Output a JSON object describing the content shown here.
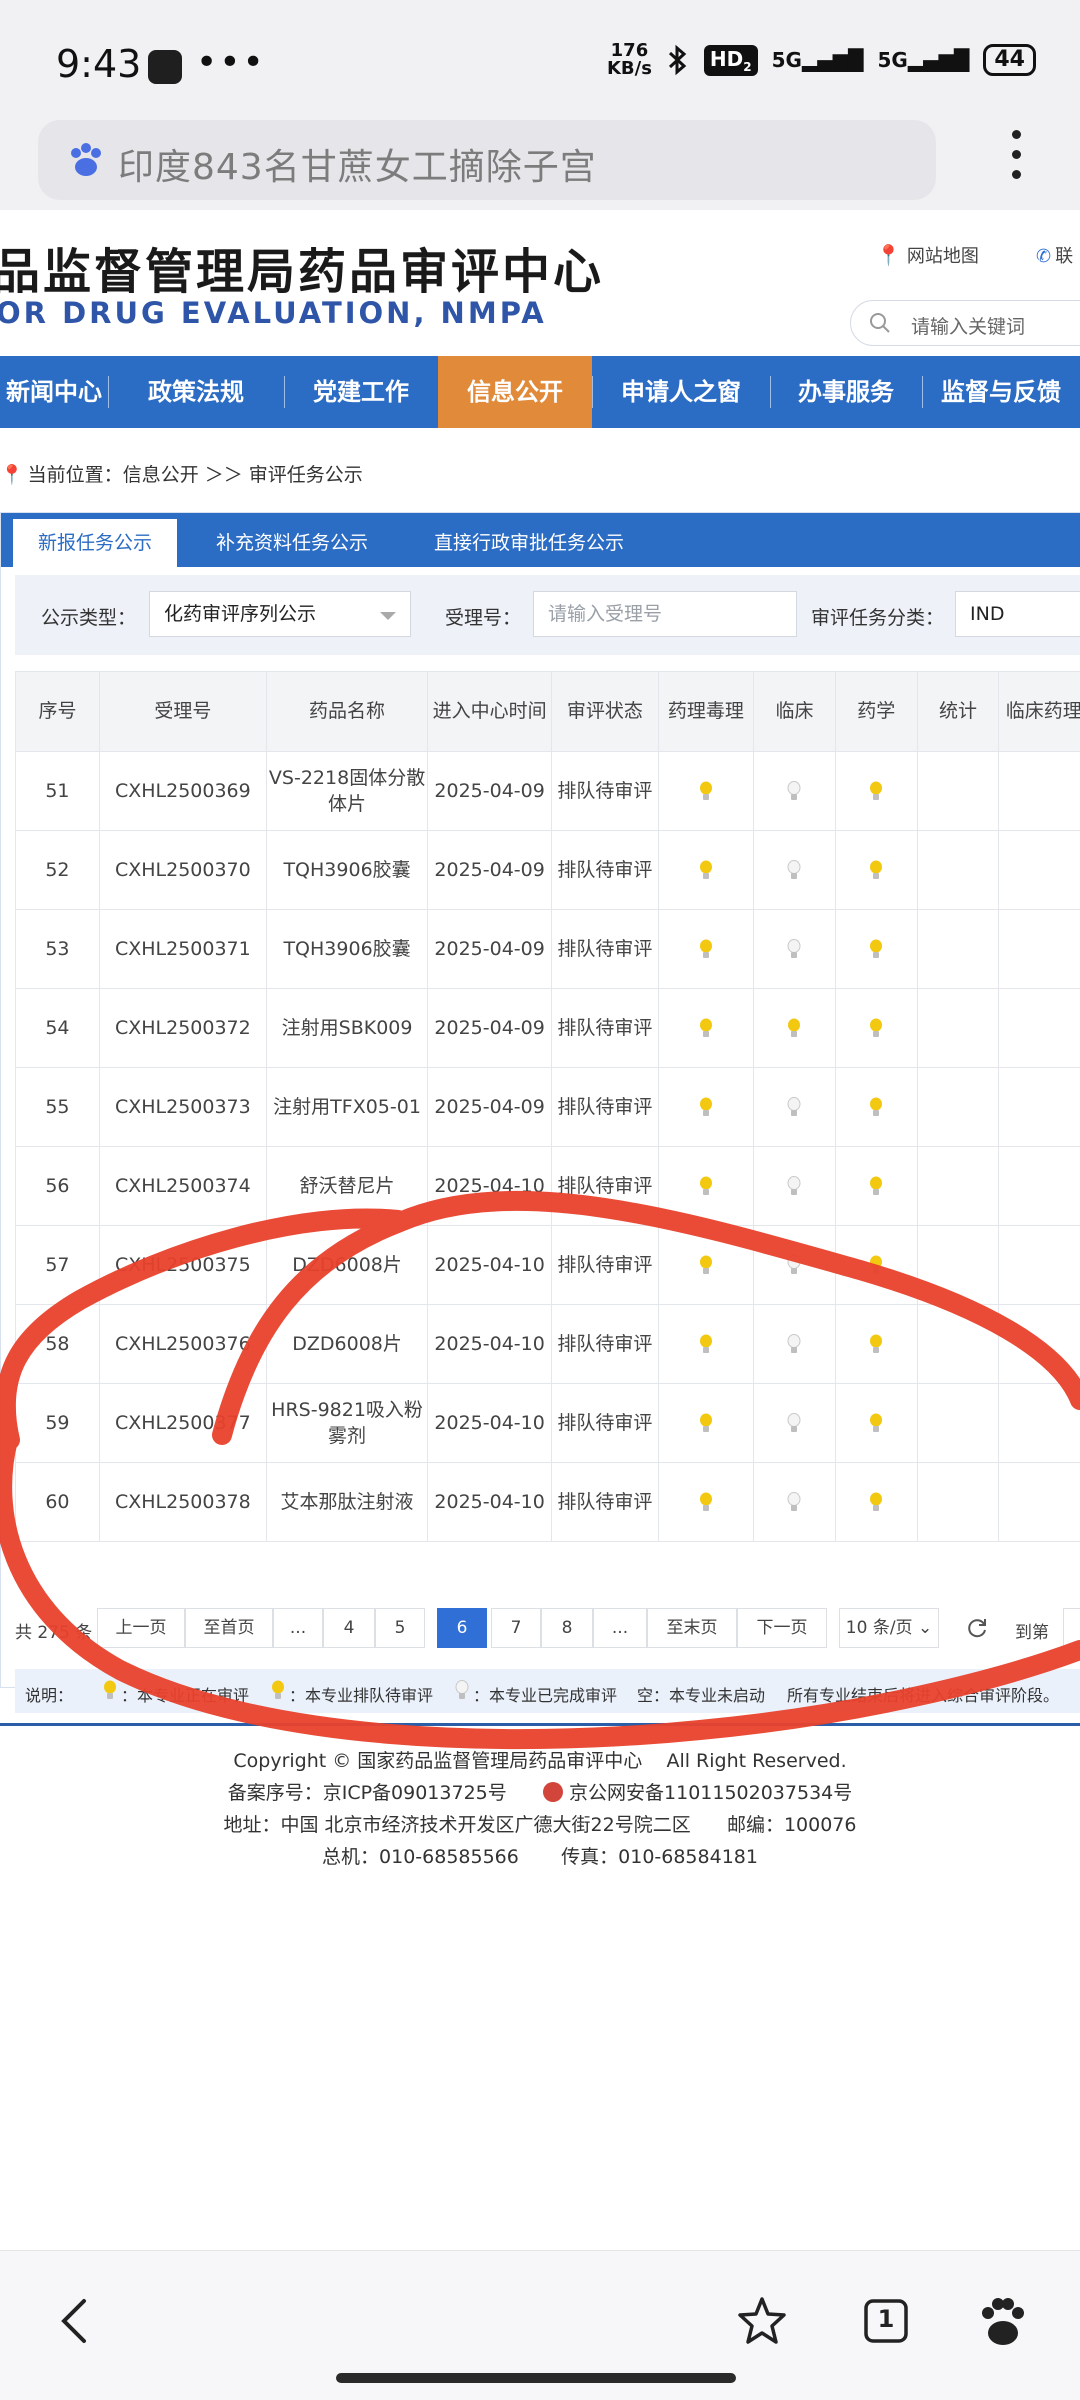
{
  "status_bar": {
    "time": "9:43",
    "dots": "•••",
    "net_speed_top": "176",
    "net_speed_bottom": "KB/s",
    "hd": "HD",
    "hd_sub": "2",
    "signal1": "5G",
    "signal2": "5G",
    "battery": "44",
    "icons": [
      "screen-record-icon",
      "bluetooth-icon",
      "signal-icon",
      "battery-icon"
    ]
  },
  "browser": {
    "search_query": "印度843名甘蔗女工摘除子宫",
    "tab_count": "1"
  },
  "site": {
    "title": "品监督管理局药品审评中心",
    "subtitle": "OR DRUG EVALUATION, NMPA",
    "sitemap": "网站地图",
    "contact": "联",
    "search_placeholder": "请输入关键词"
  },
  "nav": {
    "items": [
      "新闻中心",
      "政策法规",
      "党建工作",
      "信息公开",
      "申请人之窗",
      "办事服务",
      "监督与反馈"
    ],
    "active": "信息公开"
  },
  "breadcrumb": {
    "prefix": "当前位置：",
    "path": "信息公开 ＞＞ 审评任务公示"
  },
  "tabs": [
    "新报任务公示",
    "补充资料任务公示",
    "直接行政审批任务公示"
  ],
  "filters": {
    "type_label": "公示类型：",
    "type_value": "化药审评序列公示",
    "accept_label": "受理号：",
    "accept_placeholder": "请输入受理号",
    "category_label": "审评任务分类：",
    "category_value": "IND"
  },
  "table": {
    "headers": [
      "序号",
      "受理号",
      "药品名称",
      "进入中心时间",
      "审评状态",
      "药理毒理",
      "临床",
      "药学",
      "统计",
      "临床药理"
    ],
    "rows": [
      {
        "no": "51",
        "accept": "CXHL2500369",
        "name": "VS-2218固体分散体片",
        "date": "2025-04-09",
        "status": "排队待审评",
        "bulbs": [
          "yellow",
          "white",
          "yellow"
        ]
      },
      {
        "no": "52",
        "accept": "CXHL2500370",
        "name": "TQH3906胶囊",
        "date": "2025-04-09",
        "status": "排队待审评",
        "bulbs": [
          "yellow",
          "white",
          "yellow"
        ]
      },
      {
        "no": "53",
        "accept": "CXHL2500371",
        "name": "TQH3906胶囊",
        "date": "2025-04-09",
        "status": "排队待审评",
        "bulbs": [
          "yellow",
          "white",
          "yellow"
        ]
      },
      {
        "no": "54",
        "accept": "CXHL2500372",
        "name": "注射用SBK009",
        "date": "2025-04-09",
        "status": "排队待审评",
        "bulbs": [
          "yellow",
          "yellow",
          "yellow"
        ]
      },
      {
        "no": "55",
        "accept": "CXHL2500373",
        "name": "注射用TFX05-01",
        "date": "2025-04-09",
        "status": "排队待审评",
        "bulbs": [
          "yellow",
          "white",
          "yellow"
        ]
      },
      {
        "no": "56",
        "accept": "CXHL2500374",
        "name": "舒沃替尼片",
        "date": "2025-04-10",
        "status": "排队待审评",
        "bulbs": [
          "yellow",
          "white",
          "yellow"
        ]
      },
      {
        "no": "57",
        "accept": "CXHL2500375",
        "name": "DZD6008片",
        "date": "2025-04-10",
        "status": "排队待审评",
        "bulbs": [
          "yellow",
          "white",
          "yellow"
        ]
      },
      {
        "no": "58",
        "accept": "CXHL2500376",
        "name": "DZD6008片",
        "date": "2025-04-10",
        "status": "排队待审评",
        "bulbs": [
          "yellow",
          "white",
          "yellow"
        ]
      },
      {
        "no": "59",
        "accept": "CXHL2500377",
        "name": "HRS-9821吸入粉雾剂",
        "date": "2025-04-10",
        "status": "排队待审评",
        "bulbs": [
          "yellow",
          "white",
          "yellow"
        ]
      },
      {
        "no": "60",
        "accept": "CXHL2500378",
        "name": "艾本那肽注射液",
        "date": "2025-04-10",
        "status": "排队待审评",
        "bulbs": [
          "yellow",
          "white",
          "yellow"
        ]
      }
    ]
  },
  "pager": {
    "total": "共 275 条",
    "prev": "上一页",
    "first": "至首页",
    "ellipsis": "...",
    "pages": [
      "4",
      "5",
      "6",
      "7",
      "8"
    ],
    "active_page": "6",
    "last": "至末页",
    "next": "下一页",
    "page_size": "10 条/页",
    "goto": "到第"
  },
  "legend": {
    "label": "说明：",
    "reviewing": "：本专业正在审评",
    "queued": "：本专业排队待审评",
    "done": "：本专业已完成审评",
    "empty": "空：本专业未启动",
    "note": "所有专业结束后将进入综合审评阶段。"
  },
  "footer": {
    "copyright": "Copyright © 国家药品监督管理局药品审评中心    All Right Reserved.",
    "icp": "备案序号：京ICP备09013725号",
    "police": "京公网安备11011502037534号",
    "address": "地址：中国 北京市经济技术开发区广德大街22号院二区      邮编：100076",
    "phone": "总机：010-68585566       传真：010-68584181"
  },
  "colors": {
    "nav_blue": "#2b6cc4",
    "nav_active": "#e08a3a",
    "annotation_red": "#e8412c",
    "bulb_yellow": "#f2c811"
  }
}
